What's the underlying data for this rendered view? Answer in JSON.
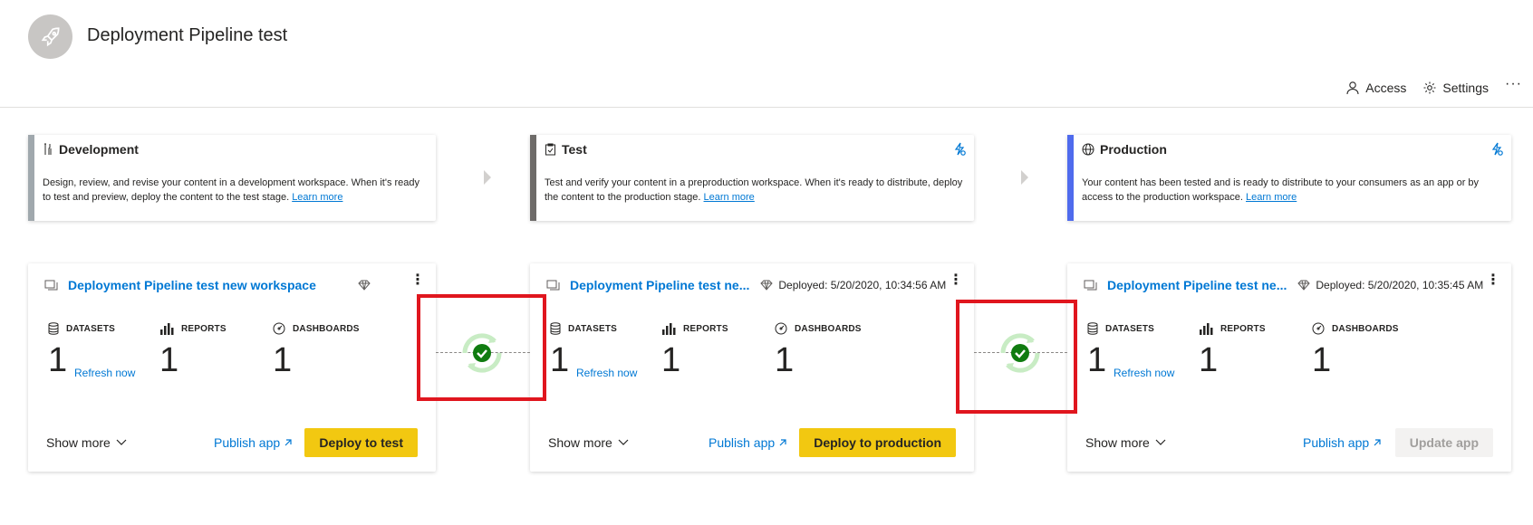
{
  "workspace": {
    "title": "Deployment Pipeline test",
    "logo_icon": "rocket-icon"
  },
  "header_actions": [
    {
      "label": "Access",
      "icon": "person-icon"
    },
    {
      "label": "Settings",
      "icon": "gear-icon"
    }
  ],
  "colors": {
    "accent_blue": "#0078d4",
    "button_yellow": "#f2c811",
    "highlight_red": "#e0161e",
    "sync_green": "#107c10",
    "dev_accent": "#a0a8ad",
    "test_accent": "#6e6b69",
    "prod_accent": "#4f6bed"
  },
  "stages": [
    {
      "title": "Development",
      "icon": "tools-icon",
      "description": "Design, review, and revise your content in a development workspace. When it's ready to test and preview, deploy the content to the test stage.",
      "learn_more": "Learn more"
    },
    {
      "title": "Test",
      "icon": "clipboard-icon",
      "description": "Test and verify your content in a preproduction workspace. When it's ready to distribute, deploy the content to the production stage.",
      "learn_more": "Learn more"
    },
    {
      "title": "Production",
      "icon": "globe-icon",
      "description": "Your content has been tested and is ready to distribute to your consumers as an app or by access to the production workspace.",
      "learn_more": "Learn more"
    }
  ],
  "workspaces": [
    {
      "name": "Deployment Pipeline test new workspace",
      "deployed": "",
      "datasets_label": "DATASETS",
      "datasets": "1",
      "reports_label": "REPORTS",
      "reports": "1",
      "dashboards_label": "DASHBOARDS",
      "dashboards": "1",
      "refresh": "Refresh now",
      "show_more": "Show more",
      "publish": "Publish app",
      "action": "Deploy to test"
    },
    {
      "name": "Deployment Pipeline test ne...",
      "deployed": "Deployed: 5/20/2020, 10:34:56 AM",
      "datasets_label": "DATASETS",
      "datasets": "1",
      "reports_label": "REPORTS",
      "reports": "1",
      "dashboards_label": "DASHBOARDS",
      "dashboards": "1",
      "refresh": "Refresh now",
      "show_more": "Show more",
      "publish": "Publish app",
      "action": "Deploy to production"
    },
    {
      "name": "Deployment Pipeline test ne...",
      "deployed": "Deployed: 5/20/2020, 10:35:45 AM",
      "datasets_label": "DATASETS",
      "datasets": "1",
      "reports_label": "REPORTS",
      "reports": "1",
      "dashboards_label": "DASHBOARDS",
      "dashboards": "1",
      "refresh": "Refresh now",
      "show_more": "Show more",
      "publish": "Publish app",
      "action": "Update app"
    }
  ]
}
